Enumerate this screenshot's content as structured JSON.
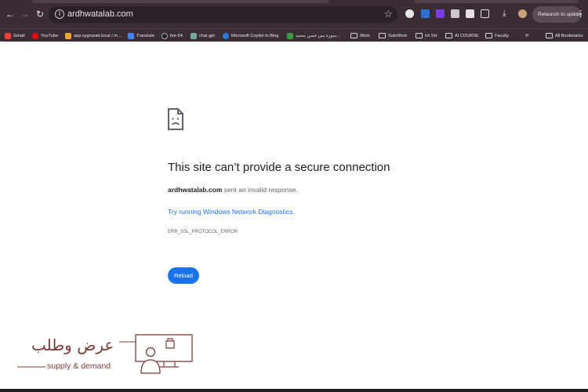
{
  "browser": {
    "url": "ardhwatalab.com",
    "relaunch_label": "Relaunch to update",
    "bookmarks": [
      {
        "label": "Gmail",
        "color": "#ea4335"
      },
      {
        "label": "YouTube",
        "color": "#ff0000"
      },
      {
        "label": "app.sygnanet.local / m...",
        "color": "#f2a33a"
      },
      {
        "label": "Translate",
        "color": "#4285f4"
      },
      {
        "label": "fee-54",
        "color": "#202124"
      },
      {
        "label": "chat gpt",
        "color": "#74aa9c"
      },
      {
        "label": "Microsoft Copilot in Bing",
        "color": "#2b7bd8"
      },
      {
        "label": "سورة يس حسن محمد...",
        "color": "#3c9a3c"
      },
      {
        "label": "Work",
        "color": "folder"
      },
      {
        "label": "SoloWork",
        "color": "folder"
      },
      {
        "label": "Iot SH",
        "color": "folder"
      },
      {
        "label": "AI COURSE",
        "color": "folder"
      },
      {
        "label": "Faculty",
        "color": "folder"
      }
    ],
    "all_bookmarks_label": "All Bookmarks",
    "more_label": "»"
  },
  "error": {
    "title": "This site can’t provide a secure connection",
    "domain": "ardhwatalab.com",
    "desc_suffix": " sent an invalid response.",
    "diagnostics_link": "Try running Windows Network Diagnostics.",
    "code": "ERR_SSL_PROTOCOL_ERROR",
    "reload_label": "Reload"
  },
  "watermark": {
    "arabic_name": "عرض وطلب",
    "english_name": "supply & demand"
  },
  "colors": {
    "chrome_bg": "#3a2d36",
    "link_blue": "#1a73e8",
    "logo_brown": "#7a3f3a"
  }
}
